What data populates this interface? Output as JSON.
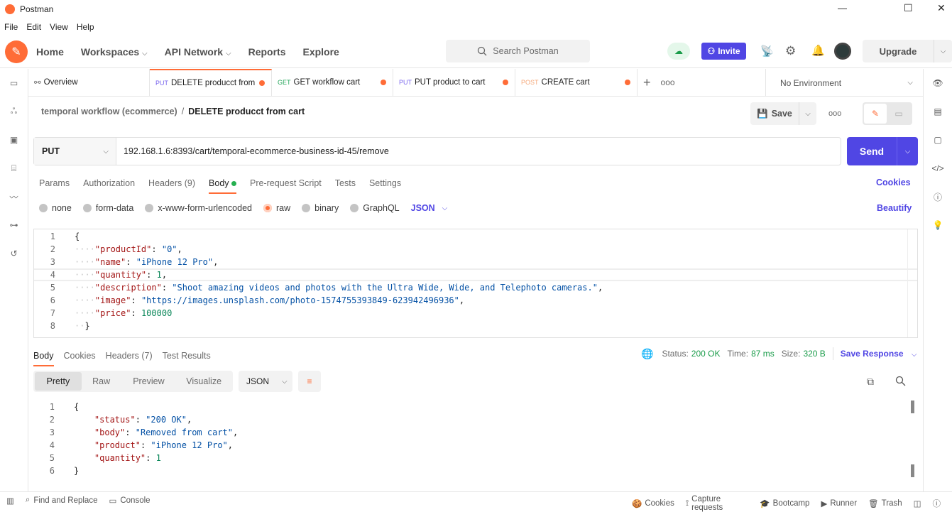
{
  "window": {
    "title": "Postman",
    "minimize": "—",
    "maximize": "☐",
    "close": "✕"
  },
  "menu": [
    "File",
    "Edit",
    "View",
    "Help"
  ],
  "header": {
    "nav": [
      {
        "label": "Home"
      },
      {
        "label": "Workspaces",
        "dropdown": true
      },
      {
        "label": "API Network",
        "dropdown": true
      },
      {
        "label": "Reports"
      },
      {
        "label": "Explore"
      }
    ],
    "search_placeholder": "Search Postman",
    "invite": "Invite",
    "upgrade": "Upgrade",
    "accent": "#ff6c37",
    "invite_color": "#5046e4"
  },
  "tabs": [
    {
      "label": "Overview",
      "icon": "overview-icon"
    },
    {
      "method": "PUT",
      "label": "DELETE producct from",
      "dirty": true,
      "active": true,
      "method_color": "#7b68ee"
    },
    {
      "method": "GET",
      "label": "GET workflow cart",
      "dirty": true,
      "method_color": "#26a65b"
    },
    {
      "method": "PUT",
      "label": "PUT product to cart",
      "dirty": true,
      "method_color": "#7b68ee"
    },
    {
      "method": "POST",
      "label": "CREATE cart",
      "dirty": true,
      "method_color": "#f5a87a"
    }
  ],
  "environment": "No Environment",
  "breadcrumb": {
    "collection": "temporal workflow (ecommerce)",
    "separator": "/",
    "request": "DELETE producct from cart"
  },
  "save": "Save",
  "request": {
    "method": "PUT",
    "url": "192.168.1.6:8393/cart/temporal-ecommerce-business-id-45/remove",
    "send": "Send",
    "tabs": [
      "Params",
      "Authorization",
      "Headers (9)",
      "Body",
      "Pre-request Script",
      "Tests",
      "Settings"
    ],
    "active_tab": "Body",
    "cookies": "Cookies",
    "body_types": [
      "none",
      "form-data",
      "x-www-form-urlencoded",
      "raw",
      "binary",
      "GraphQL"
    ],
    "selected_body_type": "raw",
    "format": "JSON",
    "beautify": "Beautify",
    "body": [
      "{",
      "    \"productId\": \"0\",",
      "    \"name\": \"iPhone 12 Pro\",",
      "    \"quantity\": 1,",
      "    \"description\": \"Shoot amazing videos and photos with the Ultra Wide, Wide, and Telephoto cameras.\",",
      "    \"image\": \"https://images.unsplash.com/photo-1574755393849-623942496936\",",
      "    \"price\": 100000",
      "  }"
    ]
  },
  "response": {
    "tabs": [
      "Body",
      "Cookies",
      "Headers (7)",
      "Test Results"
    ],
    "active_tab": "Body",
    "status_label": "Status:",
    "status": "200 OK",
    "time_label": "Time:",
    "time": "87 ms",
    "size_label": "Size:",
    "size": "320 B",
    "save_response": "Save Response",
    "views": [
      "Pretty",
      "Raw",
      "Preview",
      "Visualize"
    ],
    "active_view": "Pretty",
    "format": "JSON",
    "body": [
      "{",
      "    \"status\": \"200 OK\",",
      "    \"body\": \"Removed from cart\",",
      "    \"product\": \"iPhone 12 Pro\",",
      "    \"quantity\": 1",
      "}"
    ]
  },
  "footer": {
    "left": [
      "Find and Replace",
      "Console"
    ],
    "right": [
      "Cookies",
      "Capture requests",
      "Bootcamp",
      "Runner",
      "Trash"
    ]
  }
}
